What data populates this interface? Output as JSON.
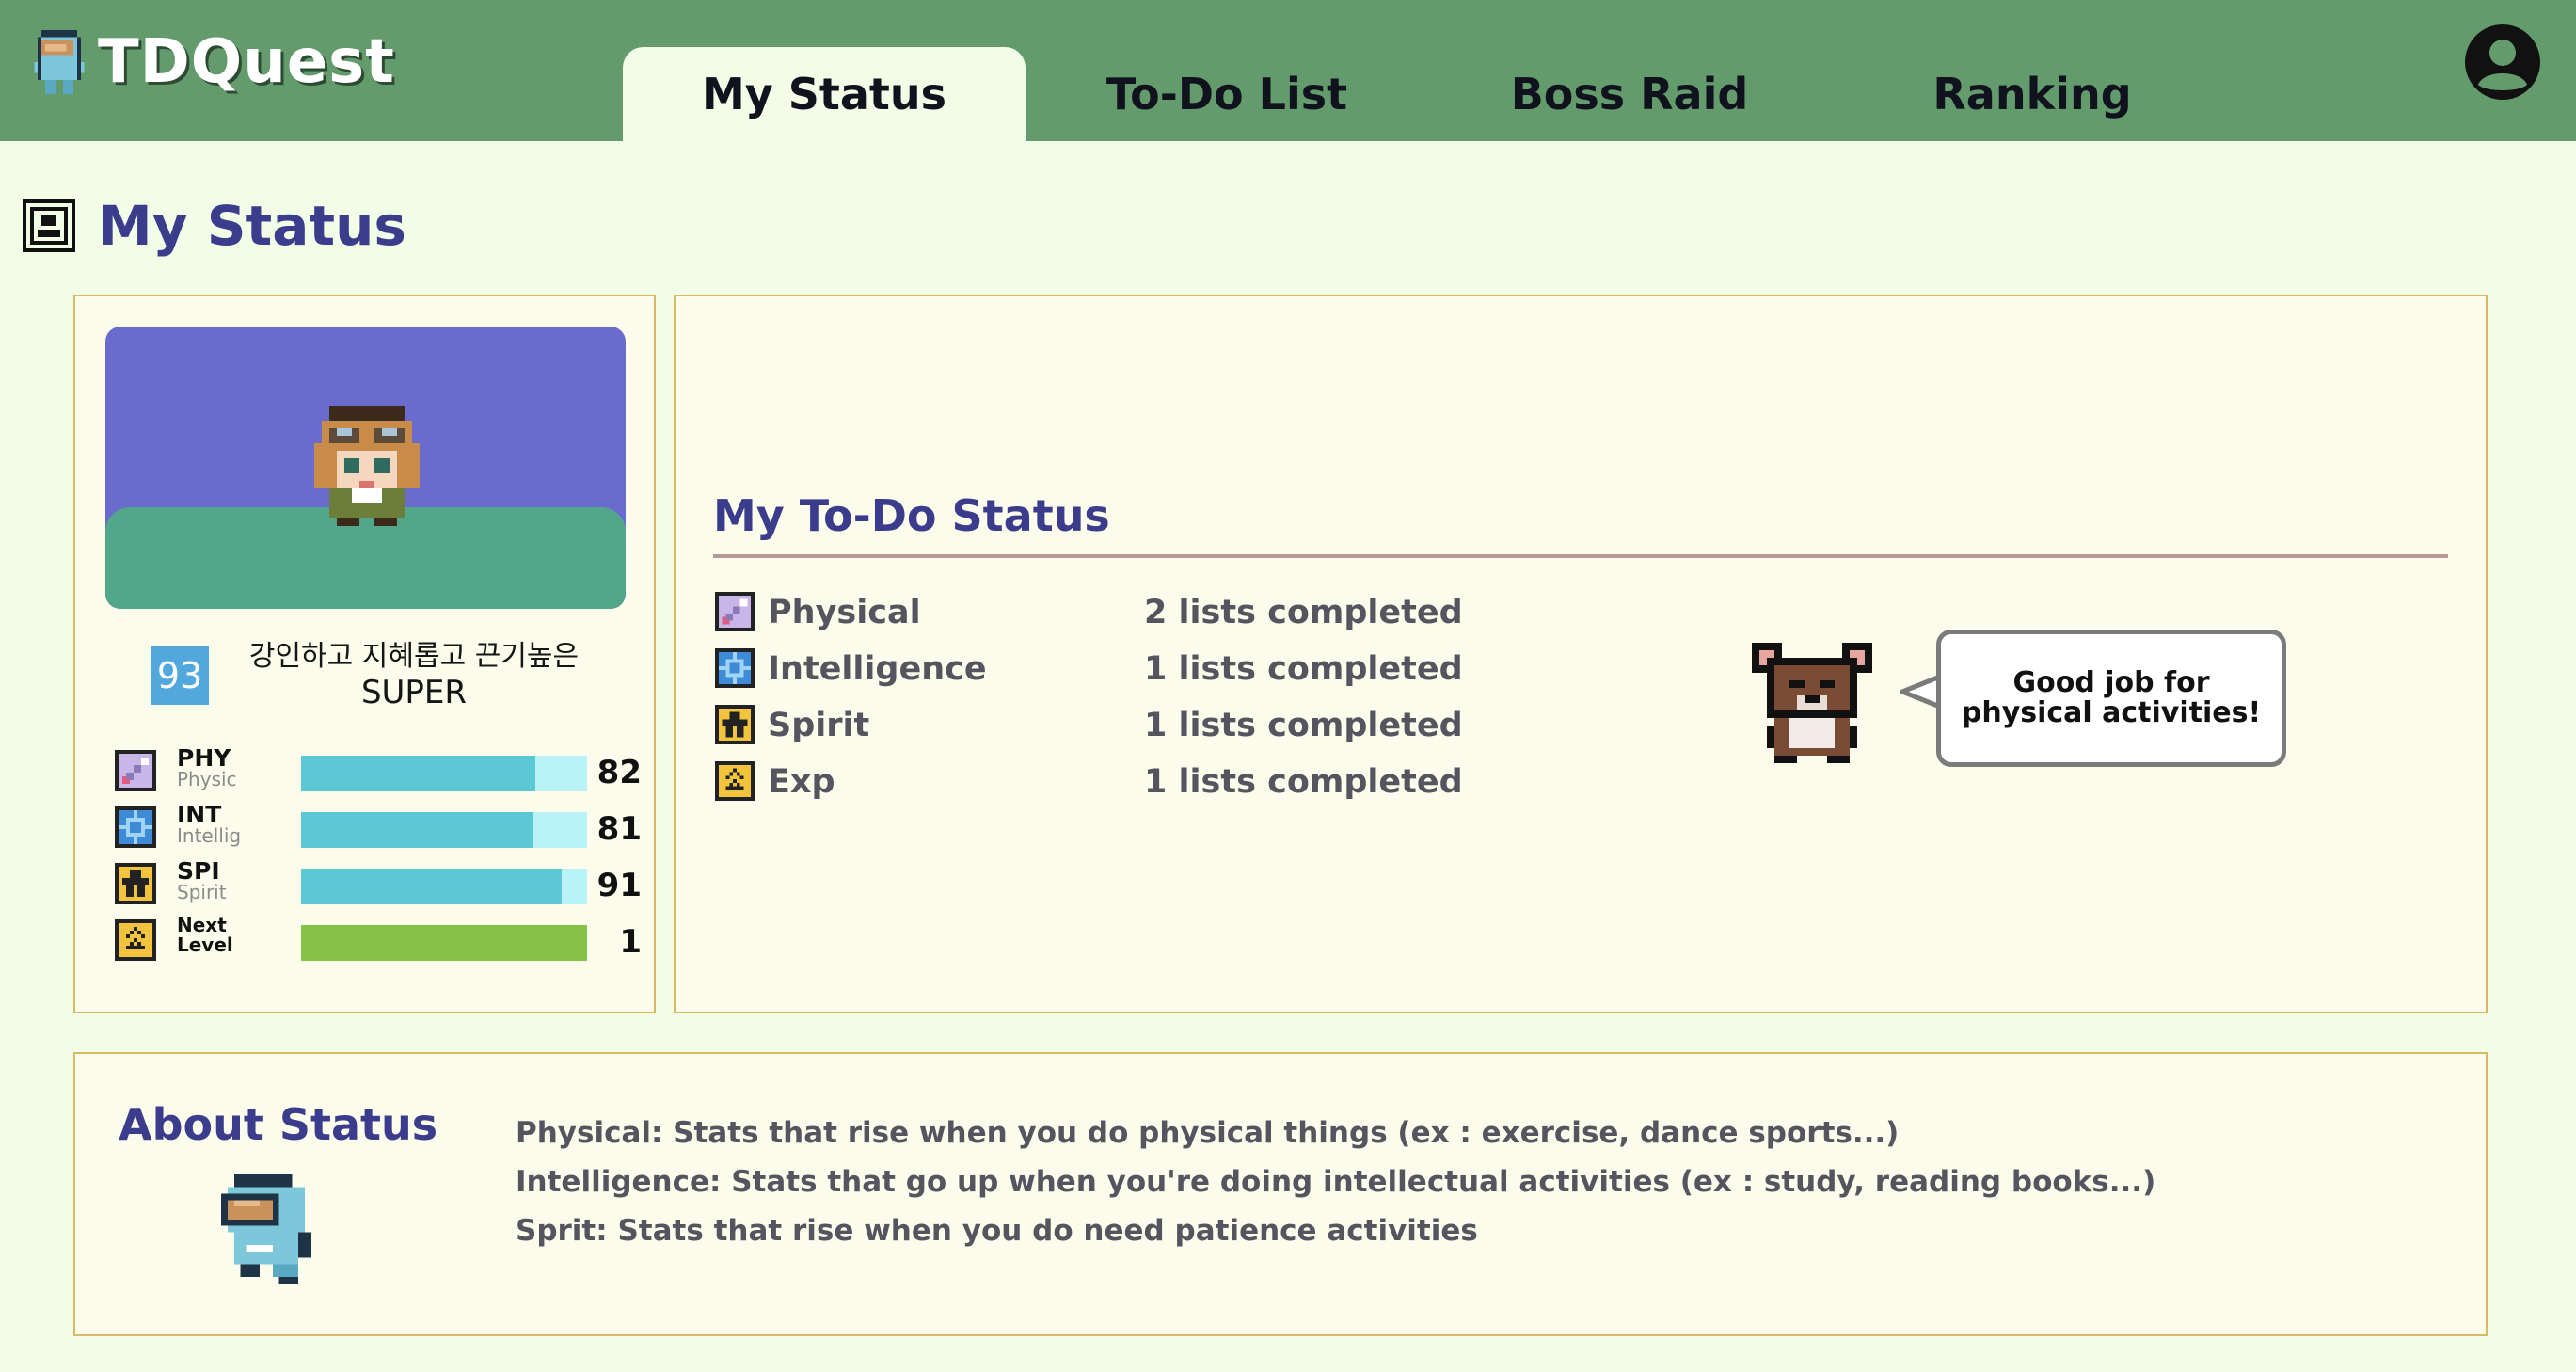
{
  "header": {
    "app_name": "TDQuest",
    "tabs": [
      {
        "label": "My Status",
        "active": true
      },
      {
        "label": "To-Do List",
        "active": false
      },
      {
        "label": "Boss Raid",
        "active": false
      },
      {
        "label": "Ranking",
        "active": false
      }
    ],
    "profile_icon": "account-circle-icon"
  },
  "page": {
    "title": "My Status",
    "title_icon": "portrait-icon"
  },
  "character": {
    "level": "93",
    "title_line1": "강인하고 지혜롭고 끈기높은",
    "title_line2": "SUPER",
    "stats": [
      {
        "abbr": "PHY",
        "sub": "Physic",
        "value": "82",
        "fraction": 0.82,
        "icon": "physical-icon"
      },
      {
        "abbr": "INT",
        "sub": "Intellig",
        "value": "81",
        "fraction": 0.81,
        "icon": "intelligence-icon"
      },
      {
        "abbr": "SPI",
        "sub": "Spirit",
        "value": "91",
        "fraction": 0.91,
        "icon": "spirit-icon"
      },
      {
        "abbr_line1": "Next",
        "abbr_line2": "Level",
        "value": "1",
        "fraction": 1.0,
        "icon": "exp-icon"
      }
    ]
  },
  "todo_status": {
    "heading": "My To-Do Status",
    "rows": [
      {
        "name": "Physical",
        "count": "2 lists completed",
        "icon": "physical-icon"
      },
      {
        "name": "Intelligence",
        "count": "1 lists completed",
        "icon": "intelligence-icon"
      },
      {
        "name": "Spirit",
        "count": "1 lists completed",
        "icon": "spirit-icon"
      },
      {
        "name": "Exp",
        "count": "1 lists completed",
        "icon": "exp-icon"
      }
    ],
    "bubble_line1": "Good job for",
    "bubble_line2": "physical activities!"
  },
  "about": {
    "heading": "About Status",
    "lines": [
      "Physical: Stats that rise when you do physical things (ex : exercise, dance sports...)",
      "Intelligence: Stats that go up when you're doing intellectual activities (ex : study, reading books...)",
      "Sprit: Stats that rise when you do need patience activities"
    ]
  },
  "colors": {
    "header_bg": "#649b6d",
    "page_bg": "#f2fde8",
    "heading": "#3b3d8c",
    "panel_border": "#d8ba62",
    "stat_bar": "#5bc8d4",
    "level_bar": "#86c24a",
    "portrait_sky": "#6b6acd",
    "portrait_ground": "#52a78b"
  }
}
